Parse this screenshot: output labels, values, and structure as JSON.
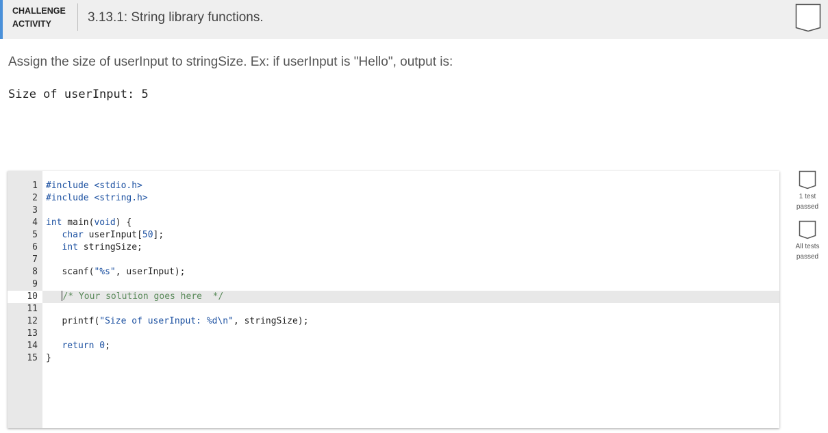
{
  "header": {
    "challenge_line1": "CHALLENGE",
    "challenge_line2": "ACTIVITY",
    "title": "3.13.1: String library functions.",
    "accent_color": "#4a90d9",
    "badge_icon": "incomplete-badge-icon"
  },
  "prompt": "Assign the size of userInput to stringSize. Ex: if userInput is \"Hello\", output is:",
  "example_output": "Size of userInput: 5",
  "editor": {
    "lines": [
      {
        "n": "1",
        "tokens": [
          {
            "c": "pp",
            "t": "#include <stdio.h>"
          }
        ]
      },
      {
        "n": "2",
        "tokens": [
          {
            "c": "pp",
            "t": "#include <string.h>"
          }
        ]
      },
      {
        "n": "3",
        "tokens": []
      },
      {
        "n": "4",
        "tokens": [
          {
            "c": "kw",
            "t": "int"
          },
          {
            "c": "pl",
            "t": " main("
          },
          {
            "c": "kw",
            "t": "void"
          },
          {
            "c": "pl",
            "t": ") {"
          }
        ]
      },
      {
        "n": "5",
        "tokens": [
          {
            "c": "pl",
            "t": "   "
          },
          {
            "c": "kw",
            "t": "char"
          },
          {
            "c": "pl",
            "t": " userInput["
          },
          {
            "c": "kw",
            "t": "50"
          },
          {
            "c": "pl",
            "t": "];"
          }
        ]
      },
      {
        "n": "6",
        "tokens": [
          {
            "c": "pl",
            "t": "   "
          },
          {
            "c": "kw",
            "t": "int"
          },
          {
            "c": "pl",
            "t": " stringSize;"
          }
        ]
      },
      {
        "n": "7",
        "tokens": []
      },
      {
        "n": "8",
        "tokens": [
          {
            "c": "pl",
            "t": "   scanf("
          },
          {
            "c": "str",
            "t": "\"%s\""
          },
          {
            "c": "pl",
            "t": ", userInput);"
          }
        ]
      },
      {
        "n": "9",
        "tokens": []
      },
      {
        "n": "10",
        "active": true,
        "tokens": [
          {
            "c": "pl",
            "t": "   "
          },
          {
            "c": "cursor",
            "t": ""
          },
          {
            "c": "cm",
            "t": "/* Your solution goes here  */"
          }
        ]
      },
      {
        "n": "11",
        "tokens": []
      },
      {
        "n": "12",
        "tokens": [
          {
            "c": "pl",
            "t": "   printf("
          },
          {
            "c": "str",
            "t": "\"Size of userInput: %d\\n\""
          },
          {
            "c": "pl",
            "t": ", stringSize);"
          }
        ]
      },
      {
        "n": "13",
        "tokens": []
      },
      {
        "n": "14",
        "tokens": [
          {
            "c": "pl",
            "t": "   "
          },
          {
            "c": "kw",
            "t": "return"
          },
          {
            "c": "pl",
            "t": " "
          },
          {
            "c": "kw",
            "t": "0"
          },
          {
            "c": "pl",
            "t": ";"
          }
        ]
      },
      {
        "n": "15",
        "tokens": [
          {
            "c": "pl",
            "t": "}"
          }
        ]
      }
    ]
  },
  "tests": [
    {
      "line1": "1 test",
      "line2": "passed",
      "icon": "test-badge-icon"
    },
    {
      "line1": "All tests",
      "line2": "passed",
      "icon": "test-badge-icon"
    }
  ]
}
